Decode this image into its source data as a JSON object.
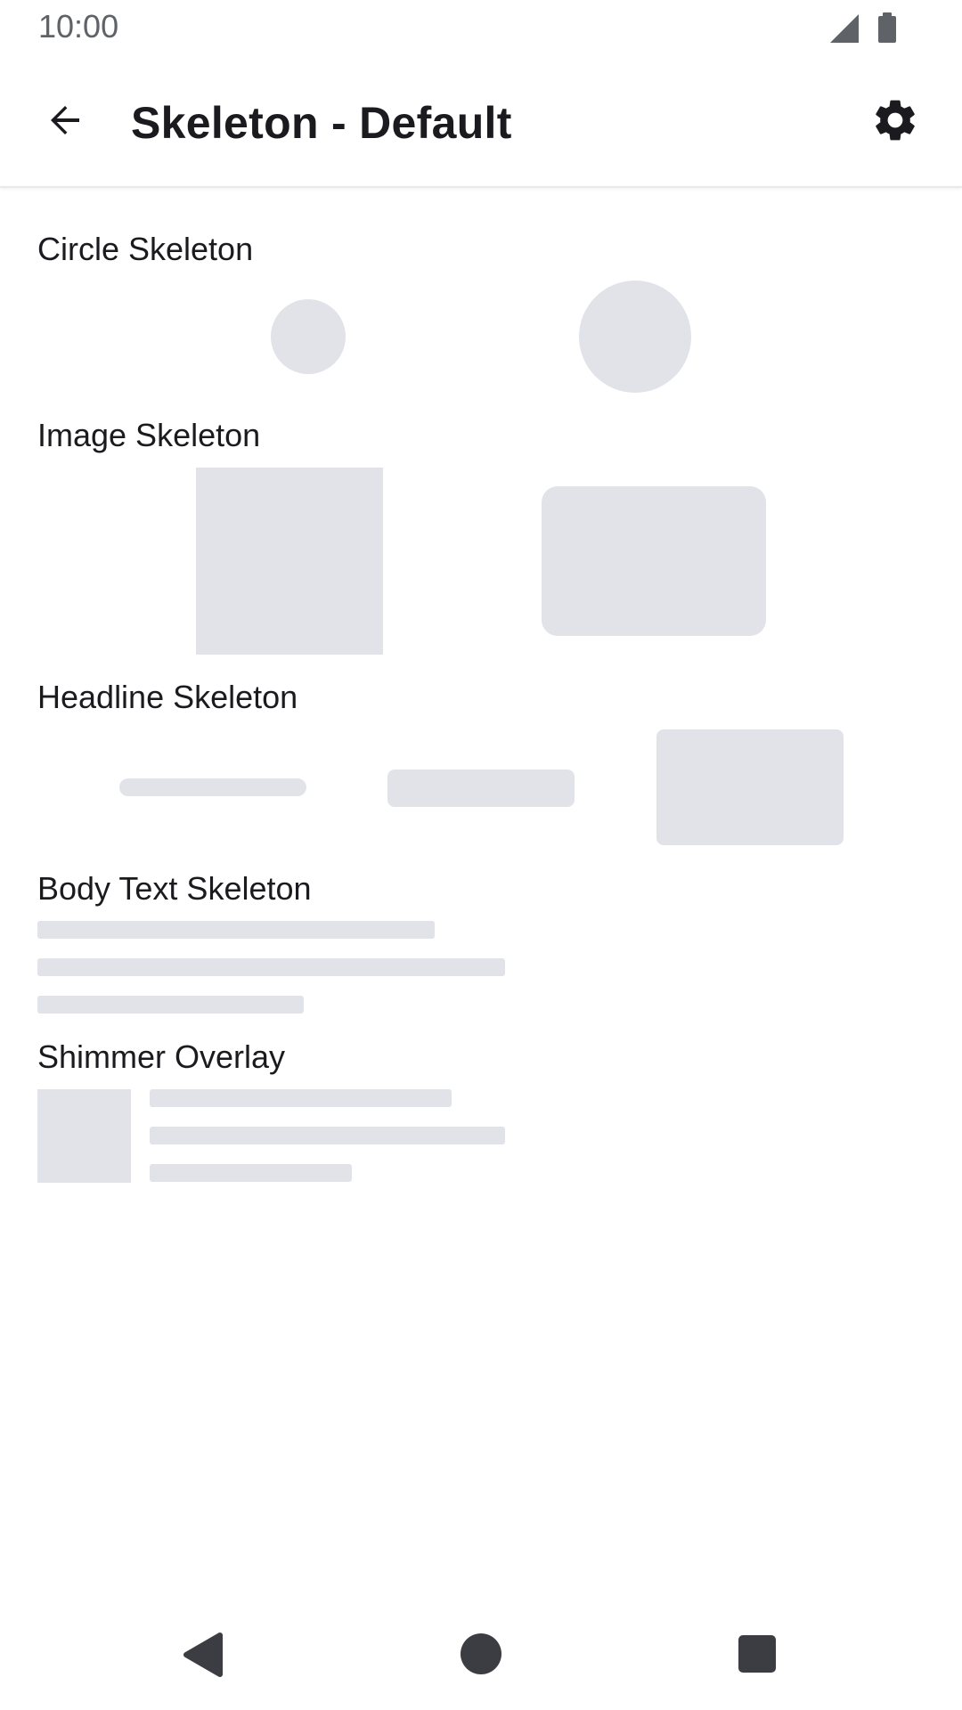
{
  "status_bar": {
    "time": "10:00"
  },
  "app_bar": {
    "title": "Skeleton - Default"
  },
  "sections": {
    "circle": {
      "label": "Circle Skeleton"
    },
    "image": {
      "label": "Image Skeleton"
    },
    "headline": {
      "label": "Headline Skeleton"
    },
    "body_text": {
      "label": "Body Text Skeleton"
    },
    "shimmer": {
      "label": "Shimmer Overlay"
    }
  },
  "colors": {
    "skeleton": "#e1e3e8",
    "text": "#1b1b1f",
    "nav_icons": "#3c3c43"
  },
  "icons": {
    "back": "arrow-back-icon",
    "settings": "gear-icon",
    "nav_back": "triangle-back-icon",
    "nav_home": "circle-home-icon",
    "nav_recent": "square-recents-icon"
  }
}
